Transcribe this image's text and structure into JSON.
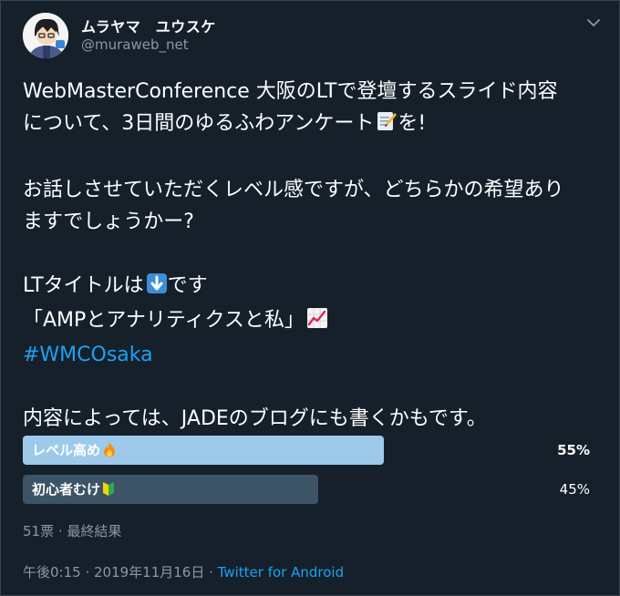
{
  "tweet": {
    "display_name": "ムラヤマ　ユウスケ",
    "handle": "@muraweb_net",
    "text": {
      "line1": "WebMasterConference 大阪のLTで登壇するスライド内容",
      "line2_text": "について、3日間のゆるふわアンケート",
      "line2_suffix": "を!",
      "line3": "お話しさせていただくレベル感ですが、どちらかの希望あり",
      "line4": "ますでしょうかー?",
      "line5_prefix": "LTタイトルは",
      "line5_suffix": "です",
      "line6": "「AMPとアナリティクスと私」",
      "hashtag": "#WMCOsaka",
      "line8": "内容によっては、JADEのブログにも書くかもです。"
    },
    "emoji": {
      "memo": "memo-icon",
      "down_arrow": "down-arrow-icon",
      "chart": "chart-increasing-icon",
      "fire": "fire-icon",
      "beginner": "beginner-mark-icon"
    }
  },
  "poll": {
    "options": [
      {
        "label": "レベル高め",
        "percent_text": "55%",
        "percent": 55,
        "winner": true
      },
      {
        "label": "初心者むけ",
        "percent_text": "45%",
        "percent": 45,
        "winner": false
      }
    ],
    "summary": "51票 · 最終結果",
    "colors": {
      "winner": "#9dcaea",
      "other": "#3d5466"
    }
  },
  "footer": {
    "timestamp": "午後0:15 · 2019年11月16日 · ",
    "source": "Twitter for Android"
  },
  "colors": {
    "background": "#15202b",
    "text": "#ffffff",
    "secondary": "#8899a6",
    "link": "#1da1f2"
  }
}
